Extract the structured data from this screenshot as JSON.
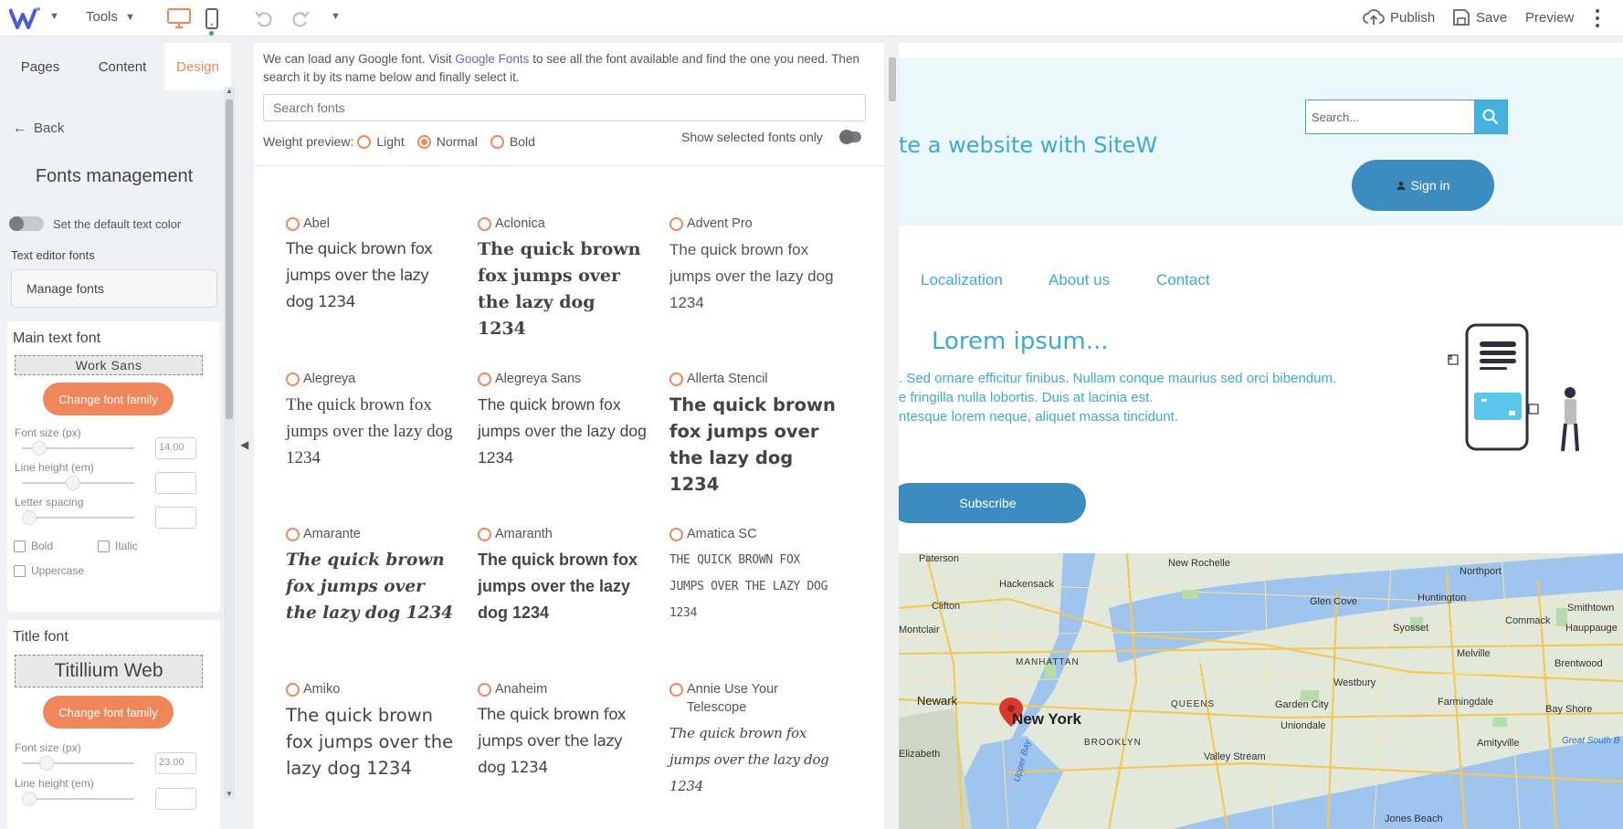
{
  "topbar": {
    "tools_label": "Tools",
    "publish_label": "Publish",
    "save_label": "Save",
    "preview_label": "Preview"
  },
  "sidebar": {
    "tabs": [
      {
        "label": "Pages",
        "active": false
      },
      {
        "label": "Content",
        "active": false
      },
      {
        "label": "Design",
        "active": true
      }
    ],
    "back_label": "Back",
    "title": "Fonts management",
    "default_color_label": "Set the default text color",
    "text_editor_fonts_label": "Text editor fonts",
    "manage_fonts_label": "Manage fonts",
    "main_font": {
      "heading": "Main text font",
      "family": "Work Sans",
      "change_label": "Change font family",
      "font_size_label": "Font size (px)",
      "font_size_value": "14.00",
      "font_size_level": 0.1,
      "line_height_label": "Line height (em)",
      "line_height_value": "",
      "line_height_level": 0.45,
      "letter_spacing_label": "Letter spacing",
      "letter_spacing_value": "",
      "letter_spacing_level": 0.0,
      "bold_label": "Bold",
      "italic_label": "Italic",
      "uppercase_label": "Uppercase"
    },
    "title_font": {
      "heading": "Title font",
      "family": "Titillium Web",
      "change_label": "Change font family",
      "font_size_label": "Font size (px)",
      "font_size_value": "23.00",
      "font_size_level": 0.18,
      "line_height_label": "Line height (em)"
    }
  },
  "fonts_panel": {
    "intro_before": "We can load any Google font. Visit ",
    "intro_link": "Google Fonts",
    "intro_after": " to see all the font available and find the one you need. Then search it by its name below and finally select it.",
    "search_placeholder": "Search fonts",
    "weight_label": "Weight preview:",
    "weights": [
      {
        "label": "Light",
        "selected": false
      },
      {
        "label": "Normal",
        "selected": true
      },
      {
        "label": "Bold",
        "selected": false
      }
    ],
    "show_selected_label": "Show selected fonts only",
    "sample_text": "The quick brown fox jumps over the lazy dog 1234",
    "fonts": [
      {
        "name": "Abel",
        "style": "condensed"
      },
      {
        "name": "Aclonica",
        "style": "heavy"
      },
      {
        "name": "Advent Pro",
        "style": "thin"
      },
      {
        "name": "Alegreya",
        "style": "serif"
      },
      {
        "name": "Alegreya Sans",
        "style": "sans"
      },
      {
        "name": "Allerta Stencil",
        "style": "stencil"
      },
      {
        "name": "Amarante",
        "style": "display"
      },
      {
        "name": "Amaranth",
        "style": "bold-sans"
      },
      {
        "name": "Amatica SC",
        "style": "caps-hand"
      },
      {
        "name": "Amiko",
        "style": "large-sans"
      },
      {
        "name": "Anaheim",
        "style": "narrow"
      },
      {
        "name": "Annie Use Your Telescope",
        "style": "hand"
      }
    ]
  },
  "website": {
    "hero_text": "te a website with SiteW",
    "search_placeholder": "Search...",
    "sign_in_label": "Sign in",
    "nav": [
      "Localization",
      "About us",
      "Contact"
    ],
    "lorem_title": "Lorem ipsum...",
    "lorem_lines": [
      ". Sed ornare efficitur finibus. Nullam conque maurius sed orci bibendum.",
      "e fringilla nulla lobortis. Duis at lacinia est.",
      "ntesque lorem neque, aliquet massa tincidunt."
    ],
    "subscribe_label": "Subscribe",
    "map": {
      "places": [
        "Paterson",
        "New Rochelle",
        "Northport",
        "Hackensack",
        "Glen Cove",
        "Huntington",
        "Clifton",
        "Commack",
        "Smithtown",
        "Syosset",
        "Hauppauge",
        "Montclair",
        "Melville",
        "MANHATTAN",
        "Brentwood",
        "Westbury",
        "Newark",
        "Farmingdale",
        "New York",
        "QUEENS",
        "Garden City",
        "Bay Shore",
        "Uniondale",
        "Elizabeth",
        "BROOKLYN",
        "Amityville",
        "Valley Stream",
        "Great South B",
        "Upper Bay",
        "Jones Beach"
      ]
    }
  }
}
